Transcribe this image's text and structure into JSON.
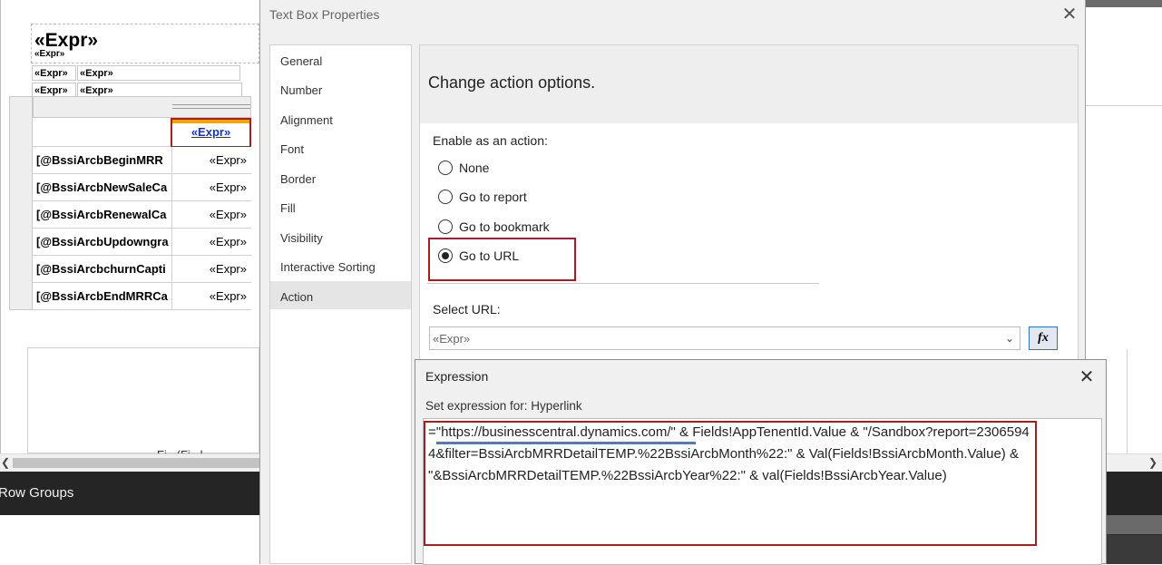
{
  "report": {
    "title": "«Expr»",
    "subtitle": "«Expr»",
    "header_cells": [
      "«Expr»",
      "«Expr»",
      "«Expr»",
      "«Expr»"
    ],
    "link_cell": "«Expr»",
    "rows": [
      {
        "label": "[@BssiArcbBeginMRR",
        "value": "«Expr»"
      },
      {
        "label": "[@BssiArcbNewSaleCa",
        "value": "«Expr»"
      },
      {
        "label": "[@BssiArcbRenewalCa",
        "value": "«Expr»"
      },
      {
        "label": "[@BssiArcbUpdowngra",
        "value": "«Expr»"
      },
      {
        "label": "[@BssiArcbchurnCapti",
        "value": "«Expr»"
      },
      {
        "label": "[@BssiArcbEndMRRCa",
        "value": "«Expr»"
      }
    ],
    "partial_text": "Fi...(Fi...l..."
  },
  "groups_bar": {
    "label": "Row Groups"
  },
  "dialog": {
    "title": "Text Box Properties",
    "close_glyph": "✕",
    "nav": [
      "General",
      "Number",
      "Alignment",
      "Font",
      "Border",
      "Fill",
      "Visibility",
      "Interactive Sorting",
      "Action"
    ],
    "active_nav": "Action",
    "heading": "Change action options.",
    "enable_label": "Enable as an action:",
    "options": [
      "None",
      "Go to report",
      "Go to bookmark",
      "Go to URL"
    ],
    "selected_option": "Go to URL",
    "select_url_label": "Select URL:",
    "url_value": "«Expr»",
    "fx_label": "fx"
  },
  "expression": {
    "title": "Expression",
    "close_glyph": "✕",
    "set_label": "Set expression for: Hyperlink",
    "text": "=\"https://businesscentral.dynamics.com/\" & Fields!AppTenentId.Value & \"/Sandbox?report=23065944&filter=BssiArcbMRRDetailTEMP.%22BssiArcbMonth%22:\" & Val(Fields!BssiArcbMonth.Value) & \"&BssiArcbMRRDetailTEMP.%22BssiArcbYear%22:\" & val(Fields!BssiArcbYear.Value)"
  },
  "colors": {
    "highlight": "#a61d24",
    "link": "#1a2fd0",
    "underline": "#4a7cc7"
  }
}
